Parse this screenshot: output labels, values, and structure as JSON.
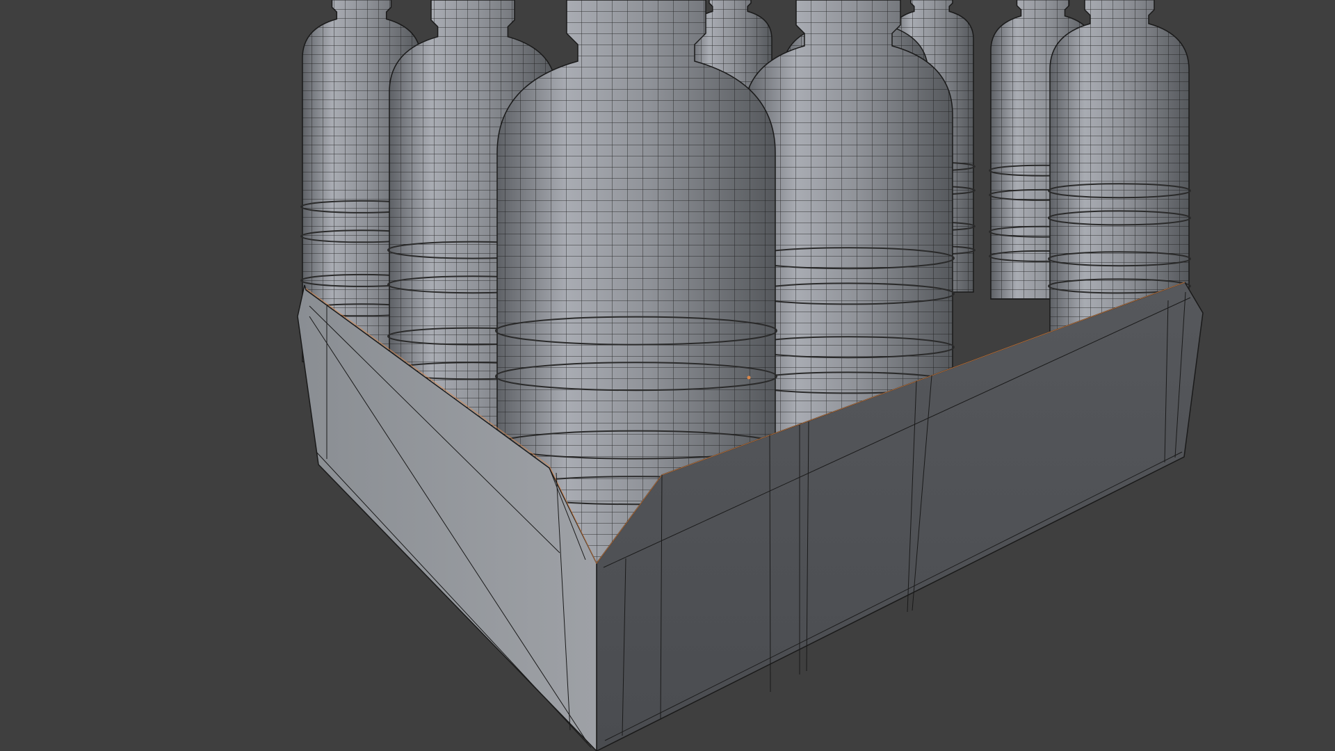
{
  "viewport": {
    "background_color": "#3f3f3f",
    "shaded_color": "#8e9196",
    "wire_color": "#1a1a1a",
    "highlight_color": "#d9874a"
  },
  "scene": {
    "objects": [
      {
        "name": "bottle",
        "count": 12
      },
      {
        "name": "cardboard-tray",
        "count": 1
      }
    ]
  }
}
